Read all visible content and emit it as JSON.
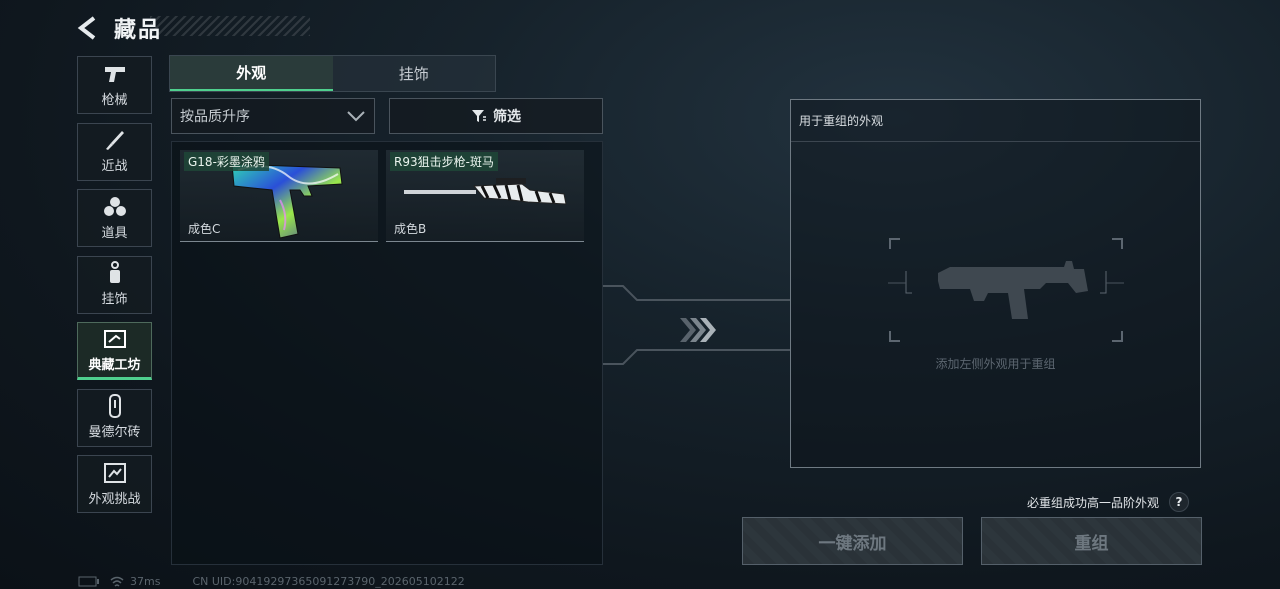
{
  "header": {
    "title": "藏品"
  },
  "sidebar": {
    "items": [
      {
        "label": "枪械",
        "icon": "pistol-icon"
      },
      {
        "label": "近战",
        "icon": "knife-icon"
      },
      {
        "label": "道具",
        "icon": "grenade-icon"
      },
      {
        "label": "挂饰",
        "icon": "charm-icon"
      },
      {
        "label": "典藏工坊",
        "icon": "workshop-icon",
        "active": true
      },
      {
        "label": "曼德尔砖",
        "icon": "brick-icon"
      },
      {
        "label": "外观挑战",
        "icon": "challenge-icon"
      }
    ]
  },
  "tabs": [
    {
      "label": "外观",
      "active": true
    },
    {
      "label": "挂饰",
      "active": false
    }
  ],
  "sort": {
    "label": "按品质升序"
  },
  "filter": {
    "label": "筛选"
  },
  "items": [
    {
      "name": "G18-彩墨涂鸦",
      "grade": "成色C"
    },
    {
      "name": "R93狙击步枪-斑马",
      "grade": "成色B"
    }
  ],
  "remix_panel": {
    "title": "用于重组的外观",
    "hint": "添加左侧外观用于重组"
  },
  "guarantee": {
    "text": "必重组成功高一品阶外观",
    "help": "?"
  },
  "buttons": {
    "add_all": "一键添加",
    "remix": "重组"
  },
  "status": {
    "ping": "37ms",
    "uid": "CN UID:904192973650912737​90_202605102122"
  },
  "colors": {
    "accent": "#4fd08e",
    "panel_border": "#6f7a83"
  }
}
